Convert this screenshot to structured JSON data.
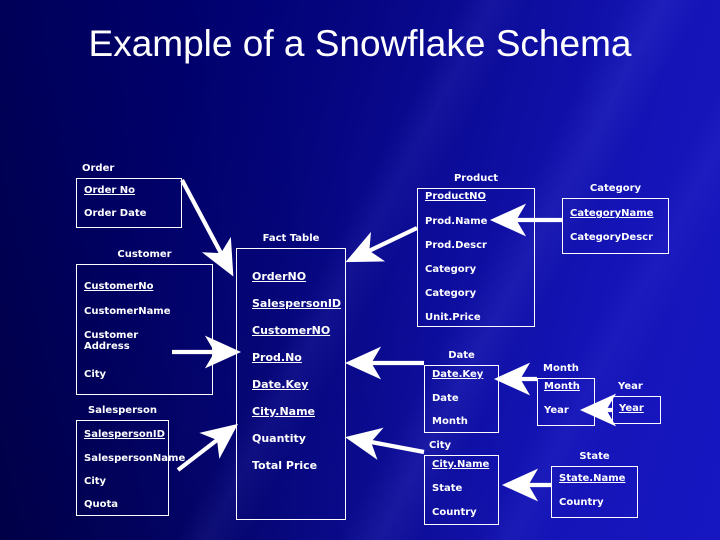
{
  "slide": {
    "title": "Example of a Snowflake Schema",
    "background_color": "#000066",
    "accent_color": "#1414b6",
    "line_color": "#ffffff"
  },
  "tables": {
    "order": {
      "caption": "Order",
      "fields": [
        "Order No",
        "Order Date"
      ]
    },
    "customer": {
      "caption": "Customer",
      "fields": [
        "CustomerNo",
        "CustomerName",
        "Customer\nAddress",
        "City"
      ]
    },
    "salesperson": {
      "caption": "Salesperson",
      "fields": [
        "SalespersonID",
        "SalespersonName",
        "City",
        "Quota"
      ]
    },
    "fact": {
      "caption": "Fact Table",
      "fields": [
        "OrderNO",
        "SalespersonID",
        "CustomerNO",
        "Prod.No",
        "Date.Key",
        "City.Name",
        "Quantity",
        "Total Price"
      ]
    },
    "product": {
      "caption": "Product",
      "fields": [
        "ProductNO",
        "Prod.Name",
        "Prod.Descr",
        "Category",
        "Category",
        "Unit.Price"
      ]
    },
    "category": {
      "caption": "Category",
      "fields": [
        "CategoryName",
        "CategoryDescr"
      ]
    },
    "date": {
      "caption": "Date",
      "fields": [
        "Date.Key",
        "Date",
        "Month"
      ]
    },
    "city": {
      "caption": "City",
      "fields": [
        "City.Name",
        "State",
        "Country"
      ]
    },
    "month": {
      "caption": "Month",
      "fields": [
        "Month",
        "Year"
      ]
    },
    "year": {
      "caption": "Year",
      "fields": [
        "Year"
      ]
    },
    "state": {
      "caption": "State",
      "fields": [
        "State.Name",
        "Country"
      ]
    }
  },
  "relationships": [
    {
      "from": "order",
      "to": "fact"
    },
    {
      "from": "customer",
      "to": "fact"
    },
    {
      "from": "salesperson",
      "to": "fact"
    },
    {
      "from": "product",
      "to": "fact"
    },
    {
      "from": "date",
      "to": "fact"
    },
    {
      "from": "city",
      "to": "fact"
    },
    {
      "from": "category",
      "to": "product"
    },
    {
      "from": "month",
      "to": "date"
    },
    {
      "from": "year",
      "to": "month"
    },
    {
      "from": "state",
      "to": "city"
    }
  ]
}
